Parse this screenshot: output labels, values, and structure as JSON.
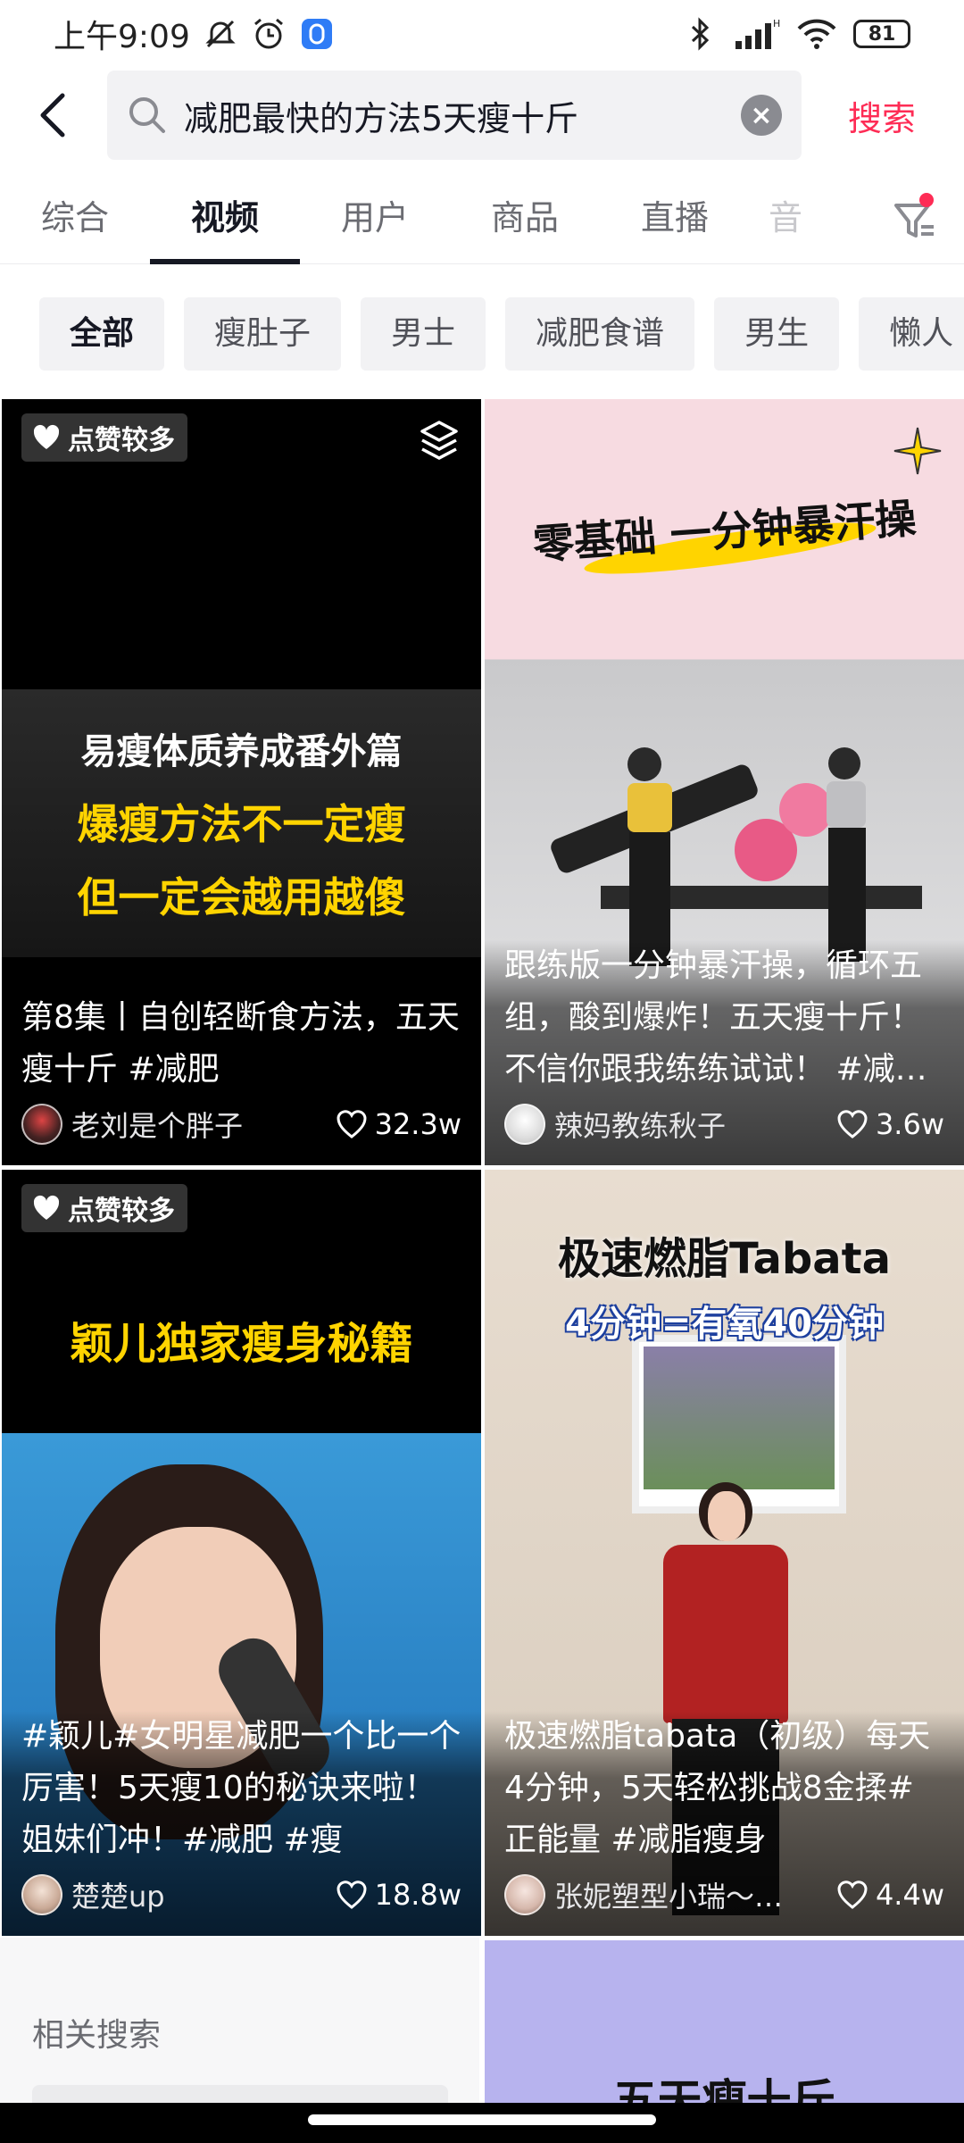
{
  "status_bar": {
    "time": "上午9:09",
    "battery": "81"
  },
  "search": {
    "query": "减肥最快的方法5天瘦十斤",
    "search_button": "搜索"
  },
  "tabs": [
    "综合",
    "视频",
    "用户",
    "商品",
    "直播",
    "音"
  ],
  "active_tab": "视频",
  "chips": [
    "全部",
    "瘦肚子",
    "男士",
    "减肥食谱",
    "男生",
    "懒人"
  ],
  "videos": [
    {
      "badge": "点赞较多",
      "overlay_lines": [
        "易瘦体质养成番外篇",
        "爆瘦方法不一定瘦",
        "但一定会越用越傻"
      ],
      "caption": "第8集丨自创轻断食方法，五天瘦十斤 #减肥",
      "author": "老刘是个胖子",
      "likes": "32.3w"
    },
    {
      "overlay_lines": [
        "零基础 一分钟暴汗操"
      ],
      "caption": "跟练版一分钟暴汗操，循环五组，酸到爆炸！五天瘦十斤！不信你跟我练练试试！ #减…",
      "author": "辣妈教练秋子",
      "likes": "3.6w"
    },
    {
      "badge": "点赞较多",
      "overlay_lines": [
        "颖儿独家瘦身秘籍"
      ],
      "caption": "#颖儿#女明星减肥一个比一个厉害！5天瘦10的秘诀来啦！姐妹们冲！#减肥 #瘦",
      "author": "楚楚up",
      "likes": "18.8w"
    },
    {
      "overlay_lines": [
        "极速燃脂Tabata",
        "4分钟=有氧40分钟"
      ],
      "caption": "极速燃脂tabata（初级）每天4分钟，5天轻松挑战8金揉#正能量 #减脂瘦身",
      "author": "张妮塑型小瑞～…",
      "likes": "4.4w"
    }
  ],
  "related": {
    "title": "相关搜索"
  },
  "peek_card": {
    "text": "五天瘦十斤"
  },
  "colors": {
    "accent": "#fe2c55",
    "tab_active": "#161823",
    "chip_bg": "#f2f2f4"
  }
}
